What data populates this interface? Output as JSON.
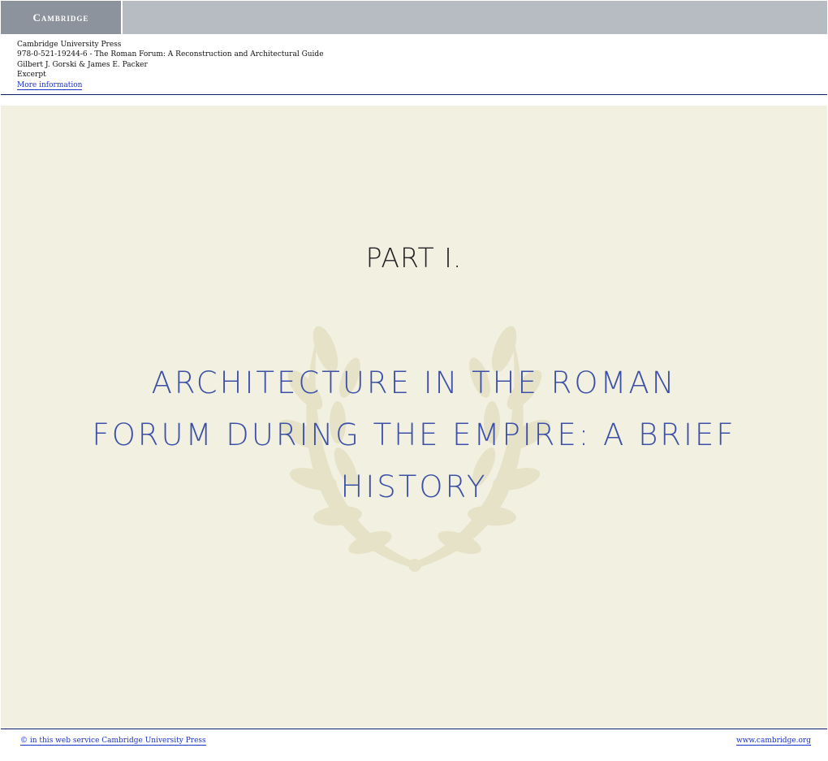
{
  "header": {
    "brand": "Cambridge",
    "publisher": "Cambridge University Press",
    "isbn_title": "978-0-521-19244-6 - The Roman Forum: A Reconstruction and Architectural Guide",
    "authors": "Gilbert J. Gorski & James E. Packer",
    "excerpt": "Excerpt",
    "more_link": "More information"
  },
  "page": {
    "part_heading": "PART I.",
    "title_line1": "ARCHITECTURE IN THE ROMAN",
    "title_line2": "FORUM DURING THE EMPIRE: A BRIEF",
    "title_line3": "HISTORY",
    "decoration": "laurel-wreath"
  },
  "footer": {
    "copyright": "© in this web service Cambridge University Press",
    "website": "www.cambridge.org"
  },
  "colors": {
    "panel": "#f2f0e0",
    "title": "#3c50a8",
    "link": "#1a32c8",
    "rule": "#0a1d6a"
  }
}
